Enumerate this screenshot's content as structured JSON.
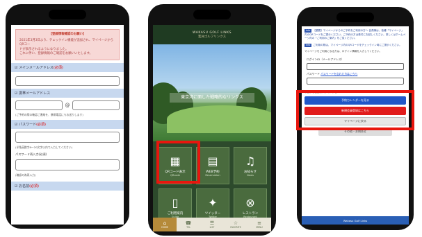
{
  "phone1": {
    "notice_title": "【登録情報確認のお願い】",
    "notice_lines": [
      "2021年3月3日より、チェックイン機能が追加され、マイページからQRコー",
      "ドが表示されるようになりました。",
      "これに伴い、登録情報のご確認をお願いいたします。"
    ],
    "sections": [
      {
        "label": "☑ メインメールアドレス",
        "required": "(必須)"
      },
      {
        "label": "☑ 携帯メールアドレス",
        "required": ""
      },
      {
        "label": "☑ パスワード",
        "required": "(必須)"
      },
      {
        "label": "☑ お名前",
        "required": "(必須)"
      }
    ],
    "at_sign": "@",
    "hint_mobile": "(ご予約の際の確認ご連絡を、携帯電話にもお送りします)",
    "hint_password": "(半角英数字6〜20文字以内で入力してください)",
    "password_confirm_label": "パスワード再入力(必須)",
    "hint_confirm": "(確認の為再入力)"
  },
  "phone2": {
    "logo_line1": "WAKASU GOLF LINKS",
    "logo_line2": "若洲ゴルフリンクス",
    "tagline": "東京湾に面した戦略的なリンクス",
    "tiles": [
      {
        "icon": "qr-code-icon",
        "glyph": "▦",
        "label": "QRコード表示",
        "sub": "QRcode"
      },
      {
        "icon": "calendar-icon",
        "glyph": "▤",
        "label": "WEB予約",
        "sub": "Reservation"
      },
      {
        "icon": "bell-icon",
        "glyph": "♫",
        "label": "お知らせ",
        "sub": "News"
      },
      {
        "icon": "phone-icon",
        "glyph": "▯",
        "label": "ご利用案内",
        "sub": "Guide"
      },
      {
        "icon": "twitter-icon",
        "glyph": "✦",
        "label": "ツイッター",
        "sub": "Twitter"
      },
      {
        "icon": "restaurant-icon",
        "glyph": "⊗",
        "label": "レストラン",
        "sub": "Restaurant"
      }
    ],
    "tabs": [
      {
        "icon": "home-icon",
        "glyph": "⌂",
        "label": "HOME"
      },
      {
        "icon": "phone-icon",
        "glyph": "☎",
        "label": "TEL"
      },
      {
        "icon": "menu-icon",
        "glyph": "☰",
        "label": "LIST"
      },
      {
        "icon": "star-icon",
        "glyph": "☆",
        "label": "FAVORITE"
      },
      {
        "icon": "more-icon",
        "glyph": "≡",
        "label": "MENU"
      }
    ]
  },
  "phone3": {
    "info_chip_1": "info",
    "info_text_1": "【重要】マイページからのご予約をご利用の方へ 会員様は、各種「マイページ」内のQRコードをご提示ください。ご予約の方は受付にお越しください。詳しくはホームページ内の「ご利用のご案内」をご覧ください。",
    "info_chip_2": "info",
    "info_text_2": "ご利用の際は、マイページ内のQRコードをチェックイン時にご提示ください。",
    "note": "マイページをご利用になる方は、ログイン情報を入力してください。",
    "login_label": "ログインID（メールアドレス）",
    "password_label": "パスワード",
    "forgot_link": "パスワードを忘れた方はこちら",
    "hint_autologin": "次回から自動でログインする",
    "btn_calendar": "予約カレンダーを見る",
    "btn_register": "新規会員登録はこちら",
    "btn_mypage": "マイページに戻る",
    "btn_more": "その他・お問合せ",
    "footer": "Wakasu Golf Links"
  },
  "colors": {
    "highlight": "#e8160e",
    "section_bg": "#c7d8ef",
    "accent_blue": "#1f56c8",
    "accent_red": "#e11b1b",
    "tab_active": "#b58a3a"
  }
}
